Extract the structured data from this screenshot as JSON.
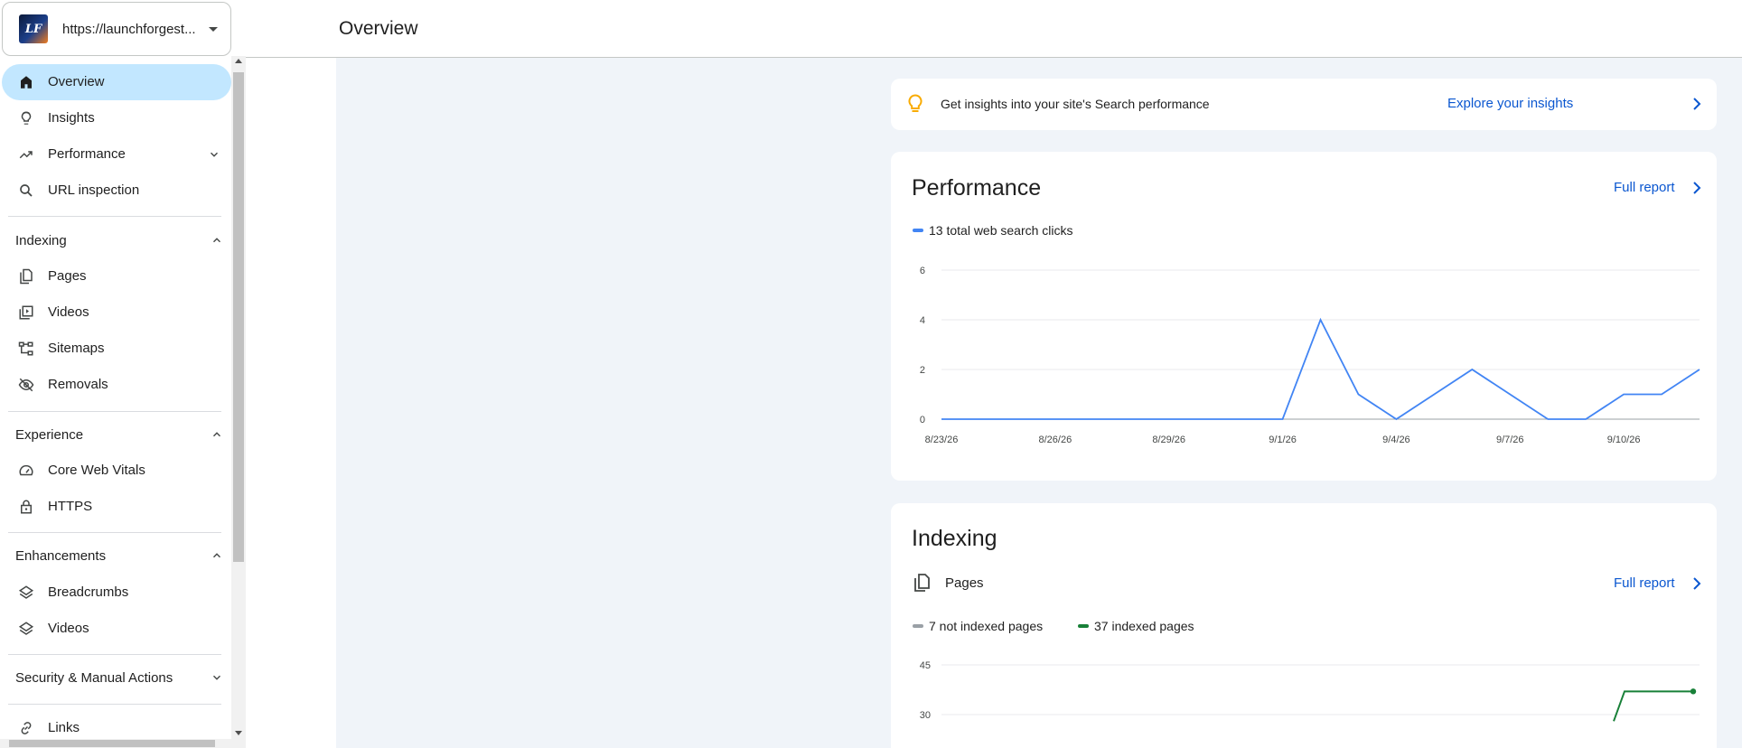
{
  "property": {
    "url": "https://launchforgest...",
    "logo_text": "LF"
  },
  "sidebar": {
    "items": [
      {
        "label": "Overview",
        "icon": "home-icon"
      },
      {
        "label": "Insights",
        "icon": "bulb-icon"
      },
      {
        "label": "Performance",
        "icon": "trending-up-icon"
      },
      {
        "label": "URL inspection",
        "icon": "search-icon"
      }
    ],
    "sections": [
      {
        "title": "Indexing",
        "items": [
          {
            "label": "Pages"
          },
          {
            "label": "Videos"
          },
          {
            "label": "Sitemaps"
          },
          {
            "label": "Removals"
          }
        ]
      },
      {
        "title": "Experience",
        "items": [
          {
            "label": "Core Web Vitals"
          },
          {
            "label": "HTTPS"
          }
        ]
      },
      {
        "title": "Enhancements",
        "items": [
          {
            "label": "Breadcrumbs"
          },
          {
            "label": "Videos"
          }
        ]
      },
      {
        "title": "Security & Manual Actions",
        "items": []
      }
    ],
    "bottom_items": [
      {
        "label": "Links"
      }
    ]
  },
  "header": {
    "title": "Overview"
  },
  "insights": {
    "text": "Get insights into your site's Search performance",
    "link": "Explore your insights"
  },
  "performance": {
    "title": "Performance",
    "link": "Full report",
    "legend": "13 total web search clicks",
    "color": "#4285f4"
  },
  "indexing": {
    "title": "Indexing",
    "pages_label": "Pages",
    "link": "Full report",
    "legend_not_indexed": "7 not indexed pages",
    "legend_indexed": "37 indexed pages",
    "not_indexed_color": "#9aa0a6",
    "indexed_color": "#188038"
  },
  "chart_data": [
    {
      "type": "line",
      "title": "",
      "x": [
        "8/23/26",
        "8/24/26",
        "8/25/26",
        "8/26/26",
        "8/27/26",
        "8/28/26",
        "8/29/26",
        "8/30/26",
        "8/31/26",
        "9/1/26",
        "9/2/26",
        "9/3/26",
        "9/4/26",
        "9/5/26",
        "9/6/26",
        "9/7/26",
        "9/8/26",
        "9/9/26",
        "9/10/26",
        "9/11/26",
        "9/12/26"
      ],
      "x_tick_labels": [
        "8/23/26",
        "8/26/26",
        "8/29/26",
        "9/1/26",
        "9/4/26",
        "9/7/26",
        "9/10/26"
      ],
      "series": [
        {
          "name": "13 total web search clicks",
          "values": [
            0,
            0,
            0,
            0,
            0,
            0,
            0,
            0,
            0,
            0,
            4,
            1,
            0,
            1,
            2,
            1,
            0,
            0,
            1,
            1,
            2
          ]
        }
      ],
      "ylim": [
        0,
        6
      ],
      "y_ticks": [
        0,
        2,
        4,
        6
      ],
      "grid": true
    },
    {
      "type": "line",
      "title": "",
      "y_ticks_visible": [
        30,
        45
      ],
      "series": [
        {
          "name": "37 indexed pages",
          "values": [
            28,
            37,
            37,
            37
          ]
        }
      ],
      "ylim": [
        0,
        45
      ],
      "grid": true
    }
  ]
}
